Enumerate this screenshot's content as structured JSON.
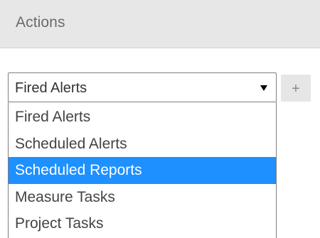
{
  "header": {
    "title": "Actions"
  },
  "select": {
    "selected_label": "Fired Alerts"
  },
  "add_button": {
    "label": "+"
  },
  "dropdown": {
    "options": [
      {
        "label": "Fired Alerts",
        "highlighted": false
      },
      {
        "label": "Scheduled Alerts",
        "highlighted": false
      },
      {
        "label": "Scheduled Reports",
        "highlighted": true
      },
      {
        "label": "Measure Tasks",
        "highlighted": false
      },
      {
        "label": "Project Tasks",
        "highlighted": false
      }
    ],
    "highlight_color": "#1e90ff"
  }
}
